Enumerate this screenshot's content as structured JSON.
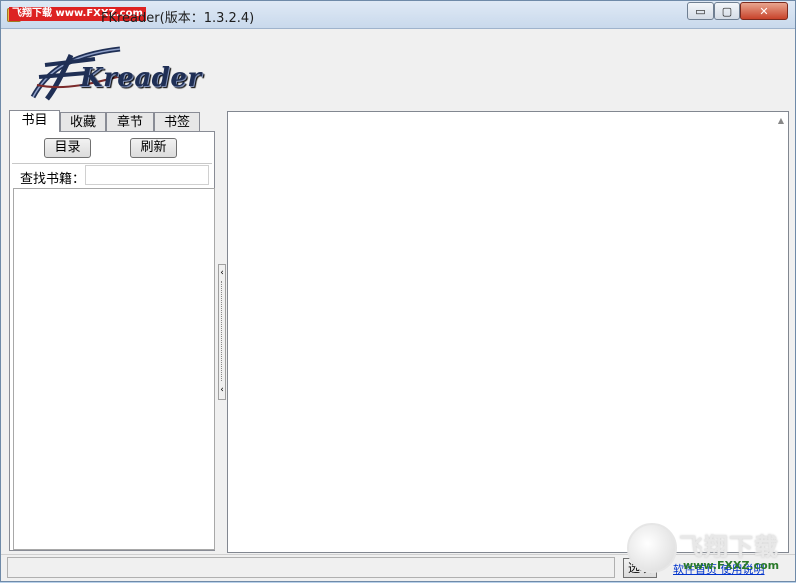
{
  "window": {
    "title": "FKreader(版本：1.3.2.4)",
    "watermark": "飞翔下载 www.FXXZ.com",
    "minimize_symbol": "▭",
    "maximize_symbol": "▢",
    "close_symbol": "✕"
  },
  "logo": {
    "text": "Kreader"
  },
  "tabs": [
    {
      "label": "书目",
      "selected": true
    },
    {
      "label": "收藏",
      "selected": false
    },
    {
      "label": "章节",
      "selected": false
    },
    {
      "label": "书签",
      "selected": false
    }
  ],
  "panel": {
    "catalog_button": "目录",
    "refresh_button": "刷新",
    "search_label": "查找书籍：",
    "search_value": ""
  },
  "splitter": {
    "up_arrow": "‹",
    "down_arrow": "‹"
  },
  "statusbar": {
    "options_button": "选项",
    "link_text": "软件首页  使用说明"
  },
  "watermark_br": {
    "cn": "飞翔下载",
    "en": "www.FXXZ.com"
  },
  "colors": {
    "close_red": "#c8432b",
    "titlebar": "#c9d9ec",
    "link_blue": "#0033cc"
  }
}
